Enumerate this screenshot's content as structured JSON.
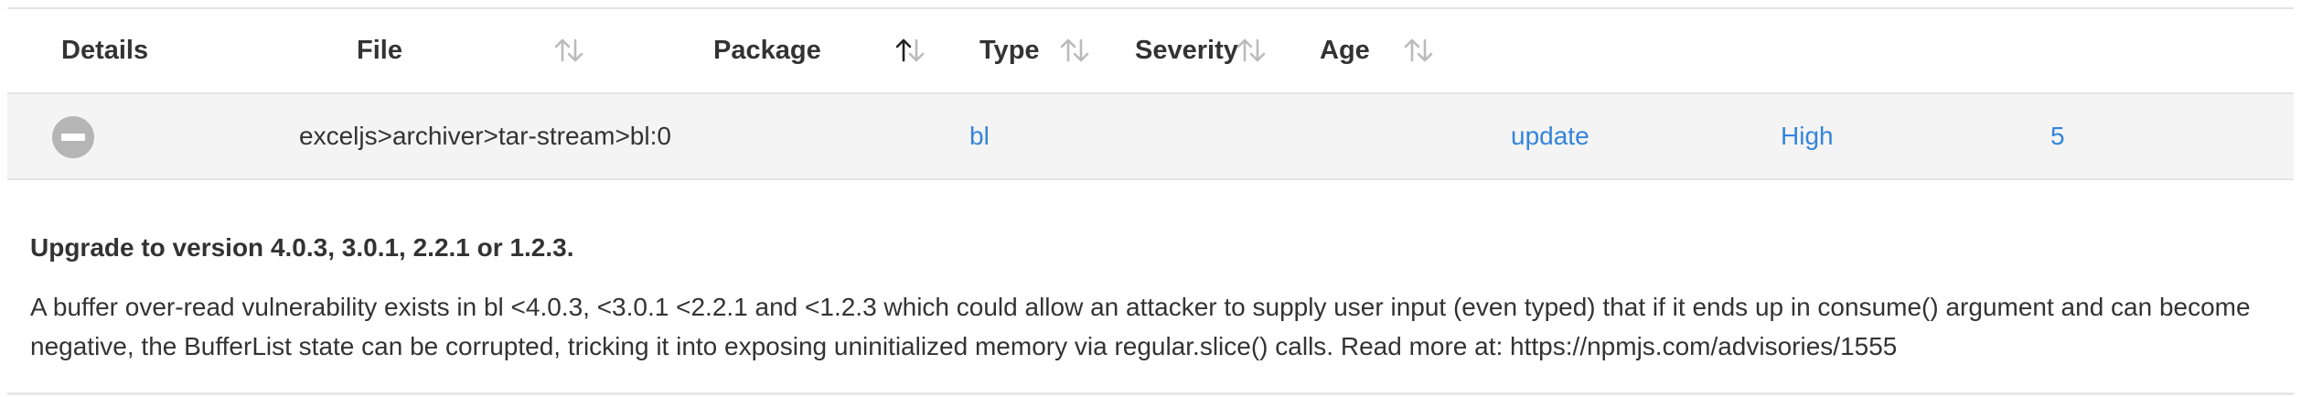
{
  "table": {
    "columns": [
      {
        "label": "Details"
      },
      {
        "label": "File"
      },
      {
        "label": "Package"
      },
      {
        "label": "Type"
      },
      {
        "label": "Severity"
      },
      {
        "label": "Age"
      }
    ],
    "sorted_column": "Package",
    "sort_direction": "ascending",
    "rows": [
      {
        "file": "exceljs>archiver>tar-stream>bl:0",
        "package": "bl",
        "type": "update",
        "severity": "High",
        "age": "5"
      }
    ]
  },
  "details": {
    "advice": "Upgrade to version 4.0.3, 3.0.1, 2.2.1 or 1.2.3.",
    "description": "A buffer over-read vulnerability exists in bl <4.0.3, <3.0.1 <2.2.1 and <1.2.3 which could allow an attacker to supply user input (even typed) that if it ends up in consume() argument and can become negative, the BufferList state can be corrupted, tricking it into exposing uninitialized memory via regular.slice() calls. Read more at: https://npmjs.com/advisories/1555"
  },
  "colors": {
    "link": "#3485db",
    "border": "#e3e3e3",
    "row_background": "#f4f4f4",
    "collapse_button": "#b5b5b5",
    "sort_icon_inactive": "#bbbbbb",
    "sort_icon_active": "#222222"
  },
  "icons": {
    "collapse": "minus-circle-icon",
    "sort": "sort-arrows-icon"
  }
}
